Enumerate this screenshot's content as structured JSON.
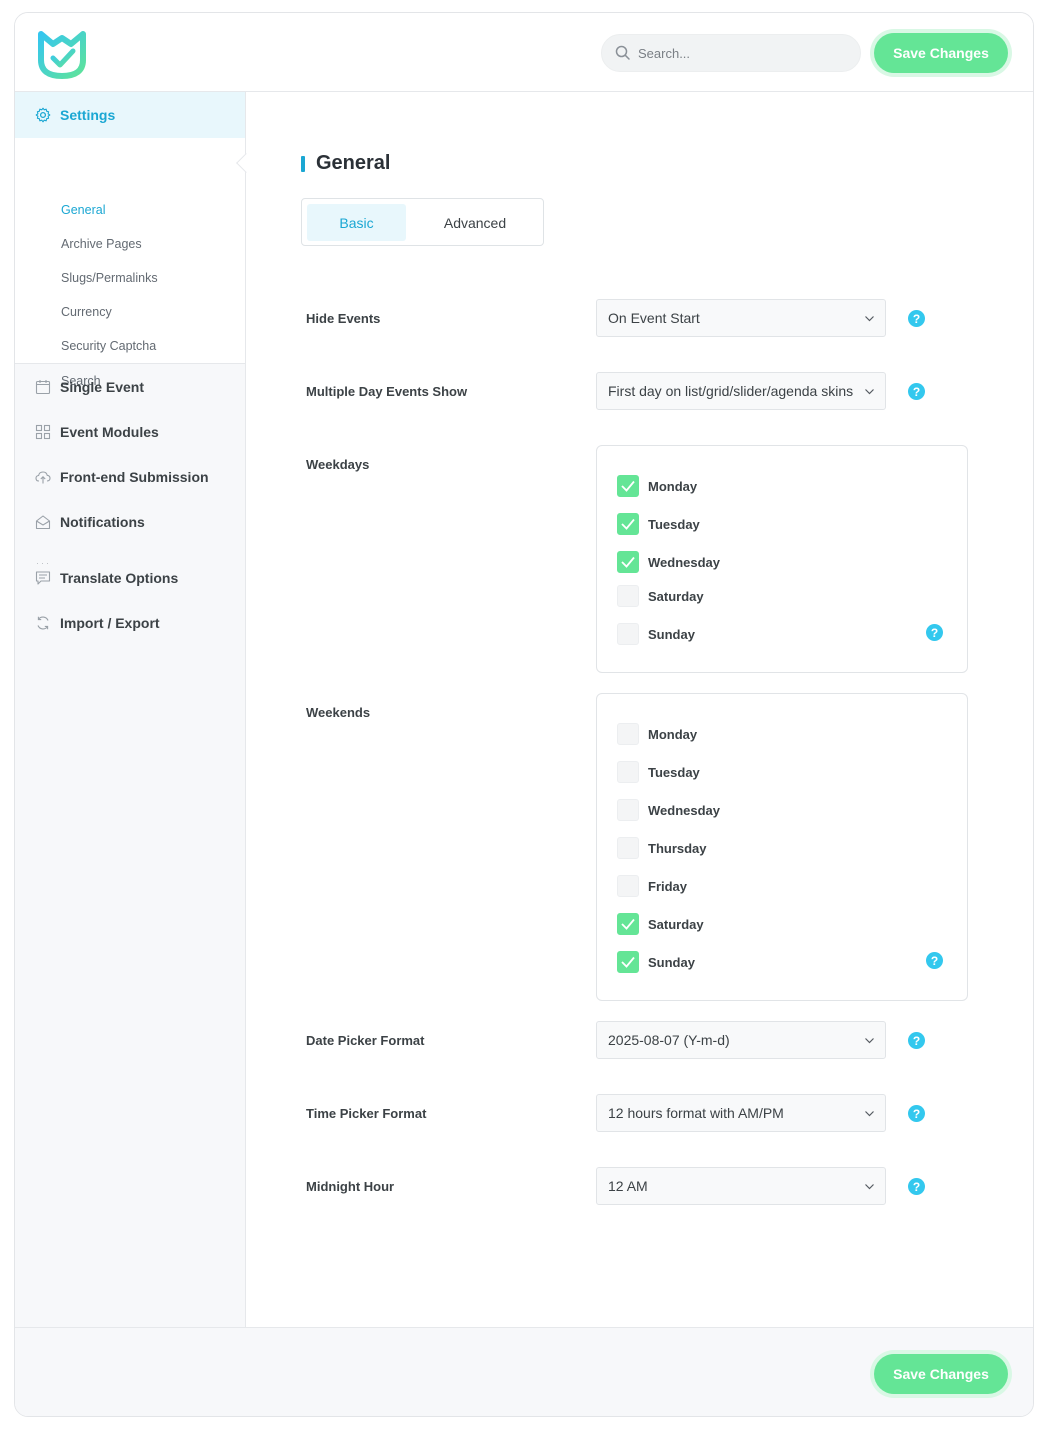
{
  "header": {
    "search_placeholder": "Search...",
    "save_label": "Save Changes"
  },
  "sidebar": {
    "active": {
      "label": "Settings",
      "icon": "gear-icon"
    },
    "submenu": [
      {
        "label": "General",
        "active": true
      },
      {
        "label": "Archive Pages"
      },
      {
        "label": "Slugs/Permalinks"
      },
      {
        "label": "Currency"
      },
      {
        "label": "Security Captcha"
      },
      {
        "label": "Search"
      }
    ],
    "items": [
      {
        "label": "Single Event",
        "icon": "calendar-icon"
      },
      {
        "label": "Event Modules",
        "icon": "grid-icon"
      },
      {
        "label": "Front-end Submission",
        "icon": "upload-cloud-icon"
      },
      {
        "label": "Notifications",
        "icon": "envelope-icon"
      },
      {
        "label": "Translate Options",
        "icon": "message-icon"
      },
      {
        "label": "Import / Export",
        "icon": "sync-icon"
      }
    ]
  },
  "main": {
    "title": "General",
    "tabs": [
      {
        "label": "Basic",
        "active": true
      },
      {
        "label": "Advanced"
      }
    ],
    "fields": {
      "hide_events": {
        "label": "Hide Events",
        "value": "On Event Start"
      },
      "multiple_day": {
        "label": "Multiple Day Events Show",
        "value": "First day on list/grid/slider/agenda skins"
      },
      "weekdays": {
        "label": "Weekdays",
        "options": [
          {
            "label": "Monday",
            "checked": true
          },
          {
            "label": "Tuesday",
            "checked": true
          },
          {
            "label": "Wednesday",
            "checked": true
          },
          {
            "label": "Saturday",
            "checked": false
          },
          {
            "label": "Sunday",
            "checked": false
          }
        ]
      },
      "weekends": {
        "label": "Weekends",
        "options": [
          {
            "label": "Monday",
            "checked": false
          },
          {
            "label": "Tuesday",
            "checked": false
          },
          {
            "label": "Wednesday",
            "checked": false
          },
          {
            "label": "Thursday",
            "checked": false
          },
          {
            "label": "Friday",
            "checked": false
          },
          {
            "label": "Saturday",
            "checked": true
          },
          {
            "label": "Sunday",
            "checked": true
          }
        ]
      },
      "date_picker": {
        "label": "Date Picker Format",
        "value": "2025-08-07 (Y-m-d)"
      },
      "time_picker": {
        "label": "Time Picker Format",
        "value": "12 hours format with AM/PM"
      },
      "midnight": {
        "label": "Midnight Hour",
        "value": "12 AM"
      }
    },
    "help_glyph": "?"
  },
  "footer": {
    "save_label": "Save Changes"
  },
  "colors": {
    "accent": "#1ba7d3",
    "success": "#64e596",
    "help": "#33c8ee"
  }
}
